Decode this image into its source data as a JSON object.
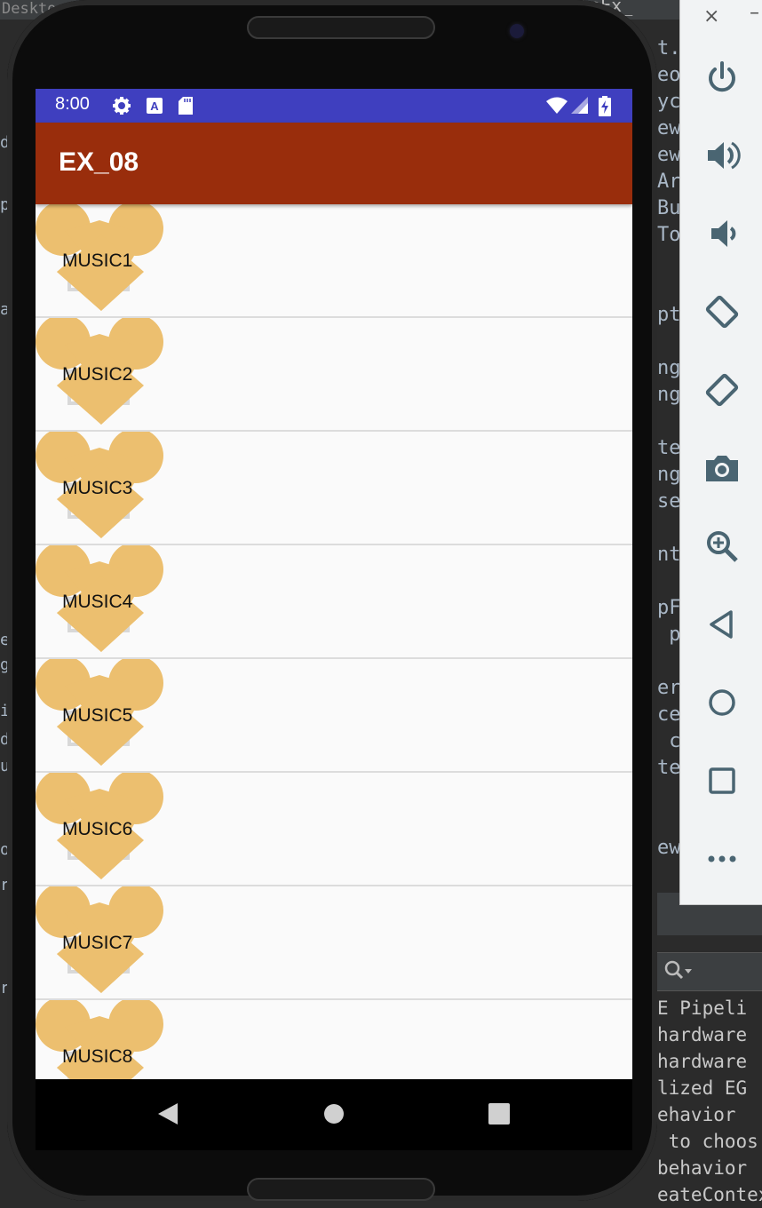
{
  "ide": {
    "top_left_text": "Deskto",
    "top_right_text": "eteEx_",
    "code_column_text": "t.C\neo\nyc\new\new\nAr\nBu\nTo\n\n\npt\n\nng\nng\n\nte\nng\nse\n\nnt\n\npF\n p\n\ner\nce:\n c\nte\n\n\new",
    "left_strip_chars": [
      "d",
      "p",
      "a",
      "e",
      "g",
      "i",
      "d",
      "u",
      "o",
      "r",
      "r"
    ],
    "console_lines": [
      "E Pipeli",
      "hardware",
      "hardware",
      "lized EG",
      "ehavior ",
      " to choos",
      "behavior ",
      "eateContex"
    ],
    "search_icon": "search-icon"
  },
  "emulator_panel": {
    "close_label": "×",
    "minimize_label": "–",
    "buttons": [
      {
        "name": "power-icon"
      },
      {
        "name": "volume-up-icon"
      },
      {
        "name": "volume-down-icon"
      },
      {
        "name": "rotate-left-icon"
      },
      {
        "name": "rotate-right-icon"
      },
      {
        "name": "camera-icon"
      },
      {
        "name": "zoom-icon"
      },
      {
        "name": "back-icon"
      },
      {
        "name": "home-icon"
      },
      {
        "name": "overview-icon"
      },
      {
        "name": "more-icon"
      }
    ]
  },
  "status_bar": {
    "time": "8:00",
    "color": "#3f3fbf"
  },
  "app_bar": {
    "title": "EX_08",
    "color": "#992d0c"
  },
  "list": {
    "heart_color": "#ecbf6f",
    "items": [
      {
        "label": "MUSIC1"
      },
      {
        "label": "MUSIC2"
      },
      {
        "label": "MUSIC3"
      },
      {
        "label": "MUSIC4"
      },
      {
        "label": "MUSIC5"
      },
      {
        "label": "MUSIC6"
      },
      {
        "label": "MUSIC7"
      },
      {
        "label": "MUSIC8"
      }
    ]
  }
}
